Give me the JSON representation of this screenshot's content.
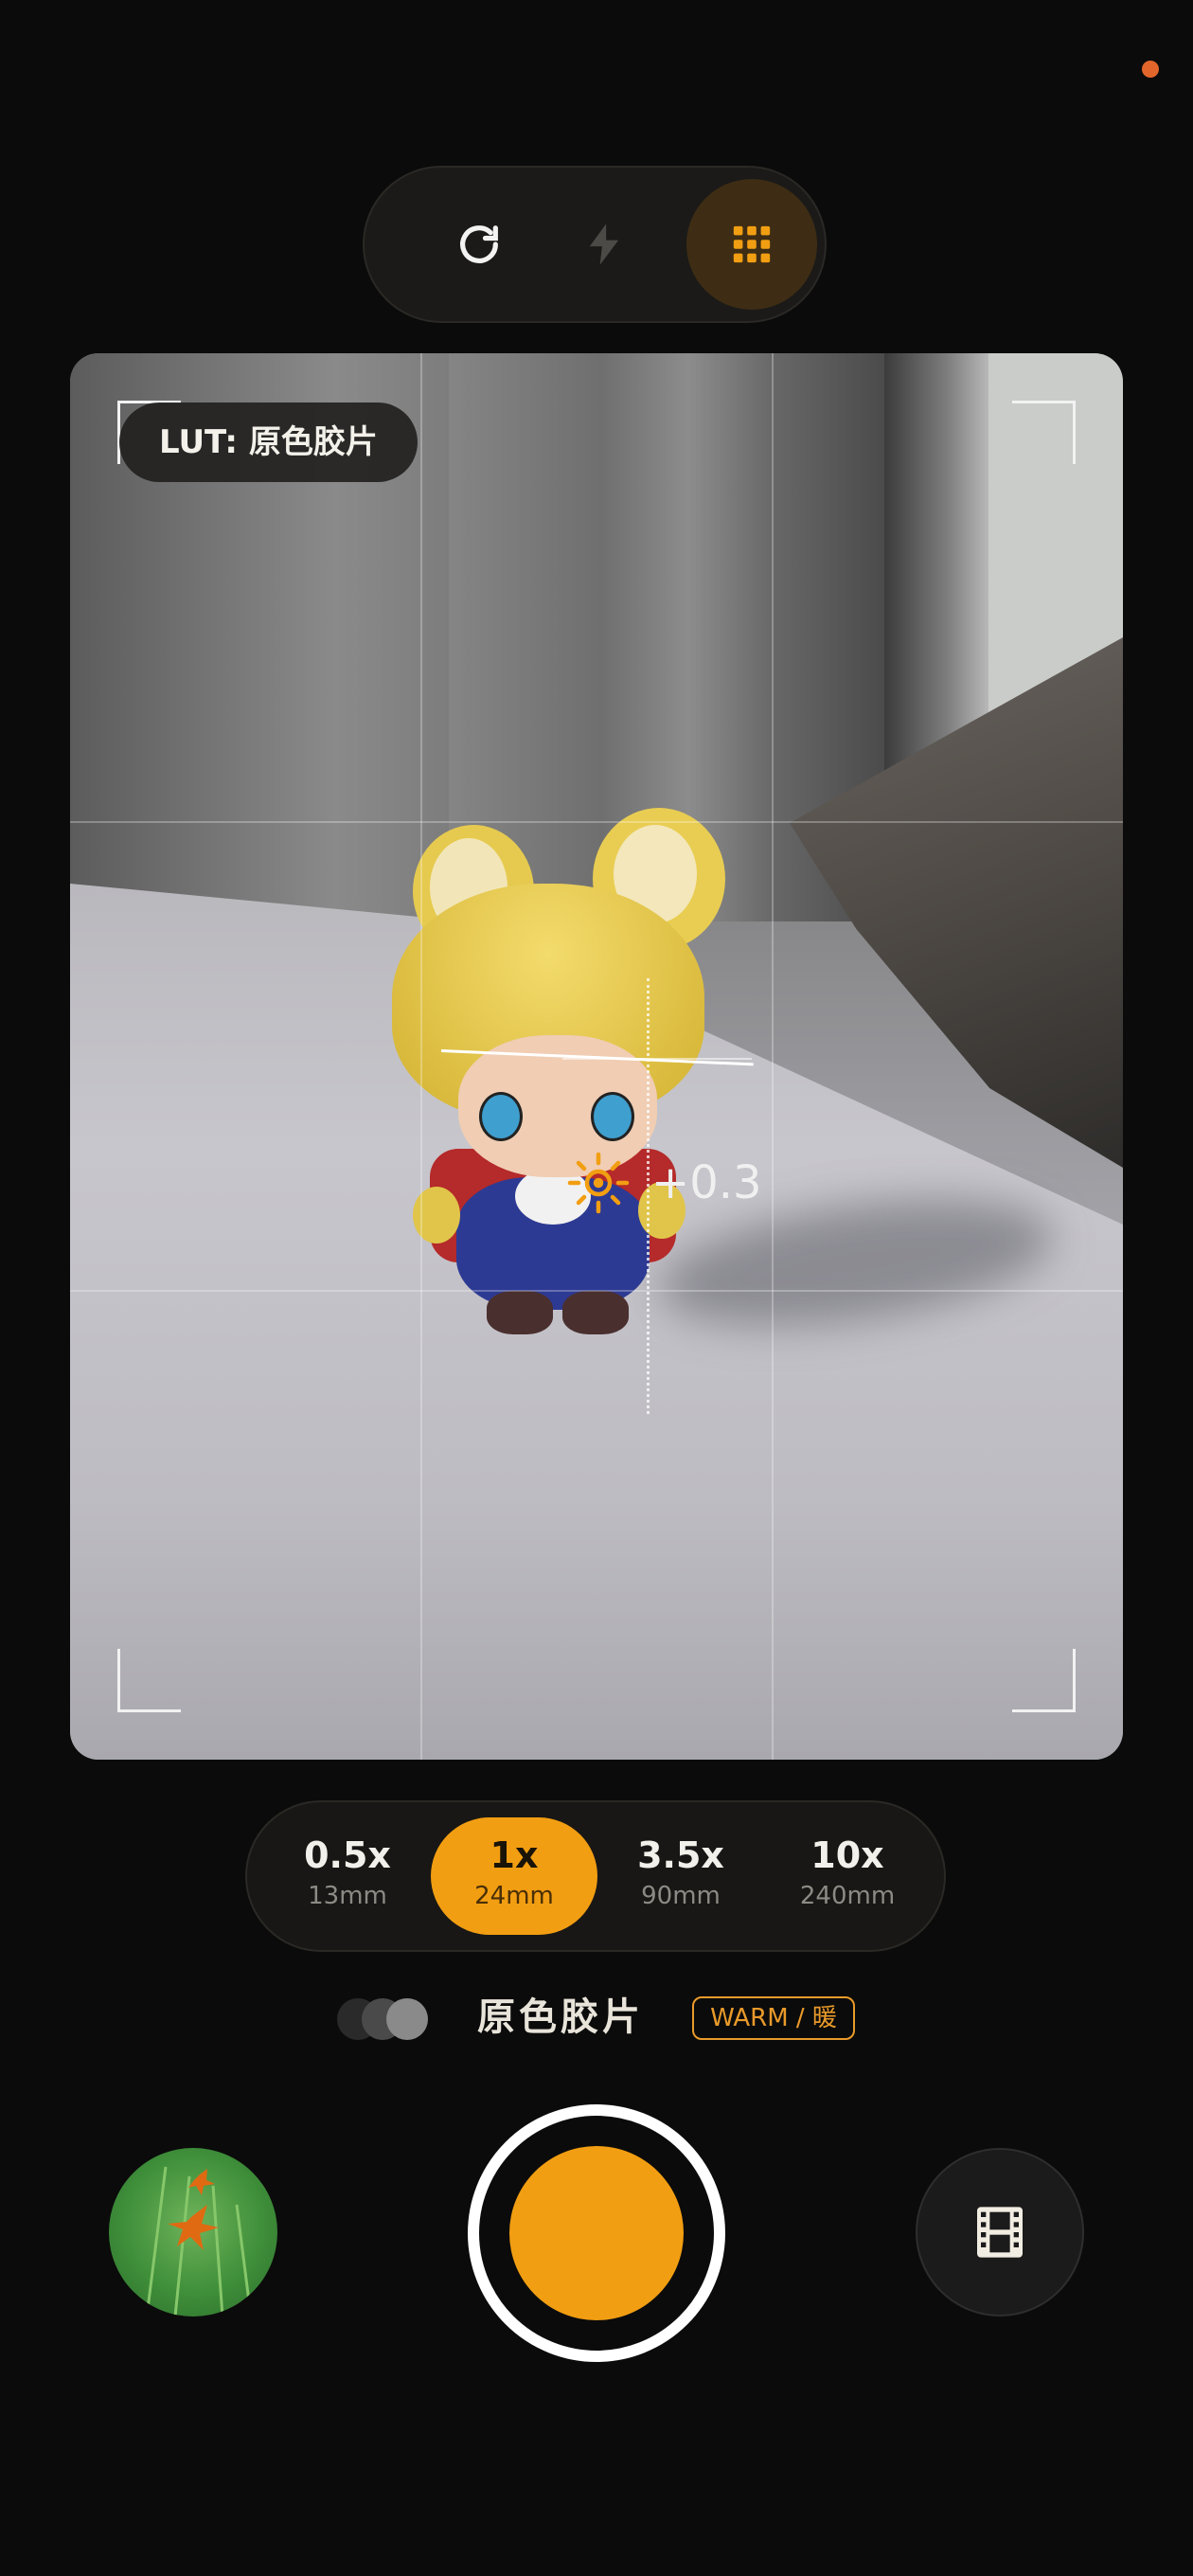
{
  "viewfinder": {
    "lut_label": "LUT: 原色胶片",
    "exposure_value": "+0.3"
  },
  "top_controls": [
    {
      "icon": "refresh-icon"
    },
    {
      "icon": "flash-icon"
    },
    {
      "icon": "grid-icon",
      "active": true
    }
  ],
  "lenses": [
    {
      "zoom": "0.5x",
      "focal": "13mm",
      "active": false
    },
    {
      "zoom": "1x",
      "focal": "24mm",
      "active": true
    },
    {
      "zoom": "3.5x",
      "focal": "90mm",
      "active": false
    },
    {
      "zoom": "10x",
      "focal": "240mm",
      "active": false
    }
  ],
  "film": {
    "name": "原色胶片",
    "badge": "WARM / 暖"
  },
  "bottom": {
    "gallery_icon": "gallery-thumbnail",
    "shutter_icon": "shutter-button",
    "film_icon": "film-strip-icon"
  },
  "colors": {
    "accent": "#f29e12",
    "background": "#0b0b0b",
    "status_dot": "#e2662b"
  }
}
